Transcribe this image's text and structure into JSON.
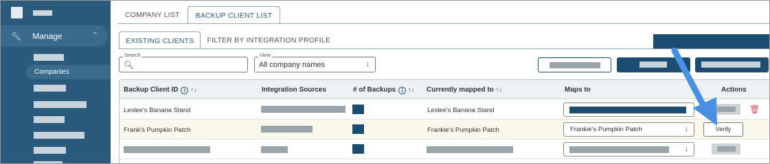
{
  "sidebar": {
    "manage_label": "Manage",
    "active_item_label": "Companies"
  },
  "tabs": [
    "COMPANY LIST",
    "BACKUP CLIENT LIST"
  ],
  "subtabs": [
    "EXISTING CLIENTS",
    "FILTER BY INTEGRATION PROFILE"
  ],
  "search": {
    "label": "Search",
    "value": ""
  },
  "view": {
    "label": "View",
    "value": "All company names"
  },
  "table": {
    "headers": {
      "backup_client_id": "Backup Client ID",
      "integration_sources": "Integration Sources",
      "num_backups": "# of Backups",
      "currently_mapped_to": "Currently mapped to",
      "maps_to": "Maps to",
      "actions": "Actions"
    },
    "rows": [
      {
        "backup_client_id": "Leslee's Banana Stand",
        "currently_mapped_to": "Leslee's Banana Stand",
        "maps_to": ""
      },
      {
        "backup_client_id": "Frank's Pumpkin Patch",
        "currently_mapped_to": "Frankie's Pumpkin Patch",
        "maps_to": "Frankie's Pumpkin Patch",
        "action_label": "Verify"
      },
      {
        "backup_client_id": "",
        "currently_mapped_to": "",
        "maps_to": ""
      }
    ]
  },
  "colors": {
    "sidebar_bg": "#2b5a7c",
    "primary": "#1a4d70",
    "annotation_arrow": "#4a90e2",
    "delete_red": "#d9534f"
  }
}
